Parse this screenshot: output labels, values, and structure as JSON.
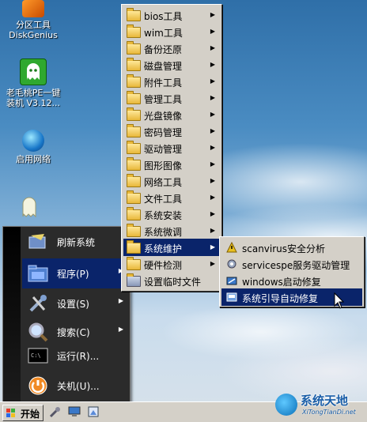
{
  "desktop": {
    "icons": [
      {
        "label": "分区工具\nDiskGenius"
      },
      {
        "label": "老毛桃PE一键\n装机 V3.12..."
      },
      {
        "label": "启用网络"
      }
    ]
  },
  "start_menu": {
    "items": [
      {
        "label": "刷新系统",
        "has_arrow": false
      },
      {
        "label": "程序(P)",
        "has_arrow": true
      },
      {
        "label": "设置(S)",
        "has_arrow": true
      },
      {
        "label": "搜索(C)",
        "has_arrow": true
      },
      {
        "label": "运行(R)...",
        "has_arrow": false
      },
      {
        "label": "关机(U)...",
        "has_arrow": false
      }
    ]
  },
  "programs_menu": {
    "items": [
      {
        "label": "bios工具",
        "has_arrow": true
      },
      {
        "label": "wim工具",
        "has_arrow": true
      },
      {
        "label": "备份还原",
        "has_arrow": true
      },
      {
        "label": "磁盘管理",
        "has_arrow": true
      },
      {
        "label": "附件工具",
        "has_arrow": true
      },
      {
        "label": "管理工具",
        "has_arrow": true
      },
      {
        "label": "光盘镜像",
        "has_arrow": true
      },
      {
        "label": "密码管理",
        "has_arrow": true
      },
      {
        "label": "驱动管理",
        "has_arrow": true
      },
      {
        "label": "图形图像",
        "has_arrow": true
      },
      {
        "label": "网络工具",
        "has_arrow": true
      },
      {
        "label": "文件工具",
        "has_arrow": true
      },
      {
        "label": "系统安装",
        "has_arrow": true
      },
      {
        "label": "系统微调",
        "has_arrow": true
      },
      {
        "label": "系统维护",
        "has_arrow": true
      },
      {
        "label": "硬件检测",
        "has_arrow": true
      },
      {
        "label": "设置临时文件",
        "has_arrow": false
      }
    ]
  },
  "maintenance_menu": {
    "items": [
      {
        "label": "scanvirus安全分析"
      },
      {
        "label": "servicespe服务驱动管理"
      },
      {
        "label": "windows启动修复"
      },
      {
        "label": "系统引导自动修复"
      }
    ]
  },
  "taskbar": {
    "start_label": "开始"
  },
  "watermark": {
    "title": "系统天地",
    "url": "XiTongTianDi.net"
  },
  "colors": {
    "menu_highlight": "#0a246a",
    "menu_bg": "#d4d0c8",
    "startmenu_bg": "#2b2b2b"
  }
}
